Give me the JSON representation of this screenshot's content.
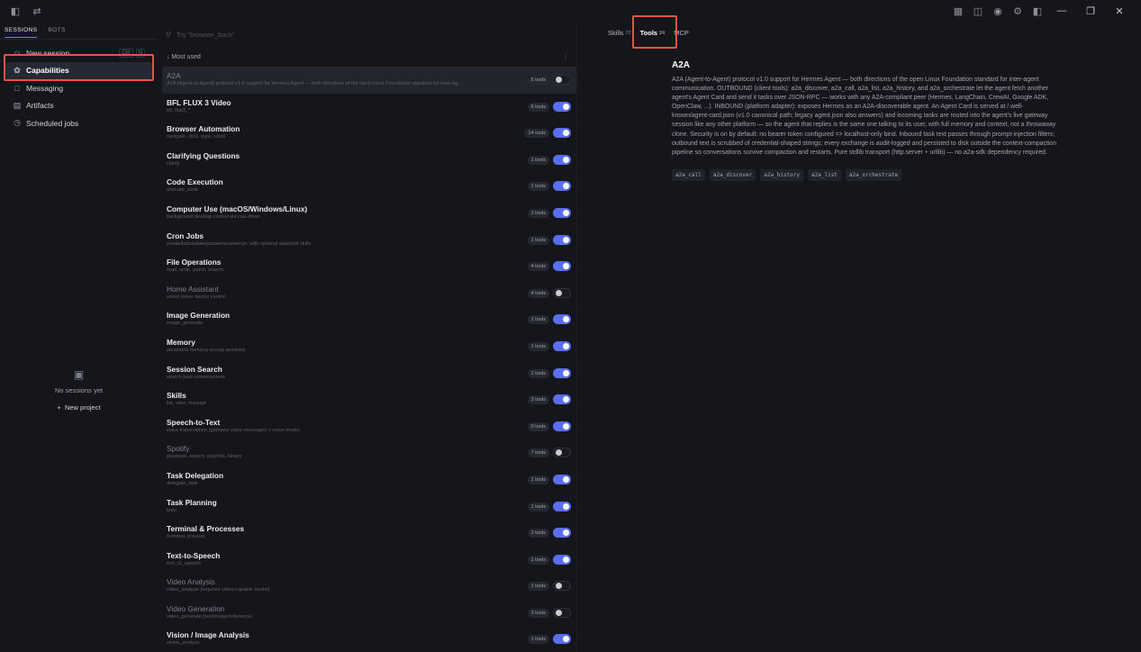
{
  "titlebar": {
    "left_icons": [
      "sidebar-toggle-icon",
      "swap-icon"
    ],
    "right_icons": [
      "layout-icon",
      "chat-icon",
      "broadcast-icon",
      "settings-icon",
      "panel-icon"
    ]
  },
  "sidebar": {
    "tabs": [
      {
        "label": "SESSIONS",
        "active": true
      },
      {
        "label": "BOTS",
        "active": false
      }
    ],
    "items": [
      {
        "label": "New session",
        "icon": "person-icon",
        "shortcut": [
          "Ctrl",
          "N"
        ]
      },
      {
        "label": "Capabilities",
        "icon": "puzzle-icon",
        "active": true
      },
      {
        "label": "Messaging",
        "icon": "message-icon"
      },
      {
        "label": "Artifacts",
        "icon": "file-icon"
      },
      {
        "label": "Scheduled jobs",
        "icon": "clock-icon"
      }
    ],
    "empty_text": "No sessions yet",
    "new_project": "New project"
  },
  "search": {
    "placeholder": "Try \"browser_back\""
  },
  "section": {
    "label": "Most used"
  },
  "tools": [
    {
      "name": "A2A",
      "desc": "A2A (Agent-to-Agent) protocol v1.0 support for Hermes Agent — both directions of the open Linux Foundation standard for inter-ag...",
      "count": "5 tools",
      "enabled": false,
      "selected": true
    },
    {
      "name": "BFL FLUX 3 Video",
      "desc": "bfl_flux3_*",
      "count": "6 tools",
      "enabled": true
    },
    {
      "name": "Browser Automation",
      "desc": "navigate, click, type, scroll",
      "count": "14 tools",
      "enabled": true
    },
    {
      "name": "Clarifying Questions",
      "desc": "clarify",
      "count": "1 tools",
      "enabled": true
    },
    {
      "name": "Code Execution",
      "desc": "execute_code",
      "count": "1 tools",
      "enabled": true
    },
    {
      "name": "Computer Use (macOS/Windows/Linux)",
      "desc": "background desktop control via cua-driver",
      "count": "1 tools",
      "enabled": true
    },
    {
      "name": "Cron Jobs",
      "desc": "create/list/update/pause/resume/run, with optional attached skills",
      "count": "1 tools",
      "enabled": true
    },
    {
      "name": "File Operations",
      "desc": "read, write, patch, search",
      "count": "4 tools",
      "enabled": true
    },
    {
      "name": "Home Assistant",
      "desc": "smart home device control",
      "count": "4 tools",
      "enabled": false
    },
    {
      "name": "Image Generation",
      "desc": "image_generate",
      "count": "1 tools",
      "enabled": true
    },
    {
      "name": "Memory",
      "desc": "persistent memory across sessions",
      "count": "1 tools",
      "enabled": true
    },
    {
      "name": "Session Search",
      "desc": "search past conversations",
      "count": "1 tools",
      "enabled": true
    },
    {
      "name": "Skills",
      "desc": "list, view, manage",
      "count": "3 tools",
      "enabled": true
    },
    {
      "name": "Speech-to-Text",
      "desc": "voice transcription (gateway voice messages + voice mode)",
      "count": "0 tools",
      "enabled": true
    },
    {
      "name": "Spotify",
      "desc": "playback, search, playlists, library",
      "count": "7 tools",
      "enabled": false
    },
    {
      "name": "Task Delegation",
      "desc": "delegate_task",
      "count": "1 tools",
      "enabled": true
    },
    {
      "name": "Task Planning",
      "desc": "todo",
      "count": "1 tools",
      "enabled": true
    },
    {
      "name": "Terminal & Processes",
      "desc": "terminal, process",
      "count": "2 tools",
      "enabled": true
    },
    {
      "name": "Text-to-Speech",
      "desc": "text_to_speech",
      "count": "1 tools",
      "enabled": true
    },
    {
      "name": "Video Analysis",
      "desc": "video_analyze (requires video-capable model)",
      "count": "1 tools",
      "enabled": false
    },
    {
      "name": "Video Generation",
      "desc": "video_generate (text/image/reference)",
      "count": "3 tools",
      "enabled": false
    },
    {
      "name": "Vision / Image Analysis",
      "desc": "vision_analyze",
      "count": "1 tools",
      "enabled": true
    }
  ],
  "top_tabs": [
    {
      "label": "Skills",
      "count": "72",
      "active": false
    },
    {
      "label": "Tools",
      "count": "24",
      "active": true
    },
    {
      "label": "MCP",
      "count": "",
      "active": false
    }
  ],
  "details": {
    "title": "A2A",
    "description": "A2A (Agent-to-Agent) protocol v1.0 support for Hermes Agent — both directions of the open Linux Foundation standard for inter-agent communication. OUTBOUND (client tools): a2a_discover, a2a_call, a2a_list, a2a_history, and a2a_orchestrate let the agent fetch another agent's Agent Card and send it tasks over JSON-RPC — works with any A2A-compliant peer (Hermes, LangChain, CrewAI, Google ADK, OpenClaw, ...). INBOUND (platform adapter): exposes Hermes as an A2A-discoverable agent. An Agent Card is served at /.well-known/agent-card.json (v1.0 canonical path; legacy agent.json also answers) and incoming tasks are routed into the agent's live gateway session like any other platform — so the agent that replies is the same one talking to its user, with full memory and context, not a throwaway clone. Security is on by default: no bearer token configured => localhost-only bind. Inbound task text passes through prompt-injection filters; outbound text is scrubbed of credential-shaped strings; every exchange is audit-logged and persisted to disk outside the context-compaction pipeline so conversations survive compaction and restarts. Pure stdlib transport (http.server + urllib) — no a2a-sdk dependency required.",
    "chips": [
      "a2a_call",
      "a2a_discover",
      "a2a_history",
      "a2a_list",
      "a2a_orchestrate"
    ]
  },
  "colors": {
    "accent": "#5a6ef0",
    "highlight": "#e5534b",
    "background": "#15161b"
  }
}
